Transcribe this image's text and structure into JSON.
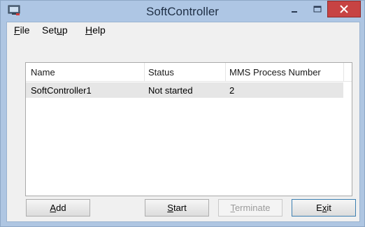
{
  "window": {
    "title": "SoftController"
  },
  "menu": [
    {
      "accel": "F",
      "rest": "ile"
    },
    {
      "pre": "Set",
      "accel": "u",
      "rest": "p"
    },
    {
      "accel": "H",
      "rest": "elp"
    }
  ],
  "list": {
    "columns": [
      "Name",
      "Status",
      "MMS Process Number"
    ],
    "rows": [
      {
        "name": "SoftController1",
        "status": "Not started",
        "mms": "2"
      }
    ]
  },
  "buttons": {
    "add": {
      "accel": "A",
      "rest": "dd"
    },
    "start": {
      "accel": "S",
      "rest": "tart"
    },
    "terminate": {
      "accel": "T",
      "rest": "erminate",
      "enabled": false
    },
    "exit": {
      "pre": "E",
      "accel": "x",
      "rest": "it"
    }
  },
  "colors": {
    "titlebar": "#aec6e4",
    "close_button": "#c74343",
    "client_bg": "#f0f0f0",
    "selected_row": "#e6e6e6"
  },
  "icons": {
    "app": "monitor-app-icon",
    "minimize": "minimize-icon",
    "maximize": "maximize-icon",
    "close": "close-icon"
  }
}
